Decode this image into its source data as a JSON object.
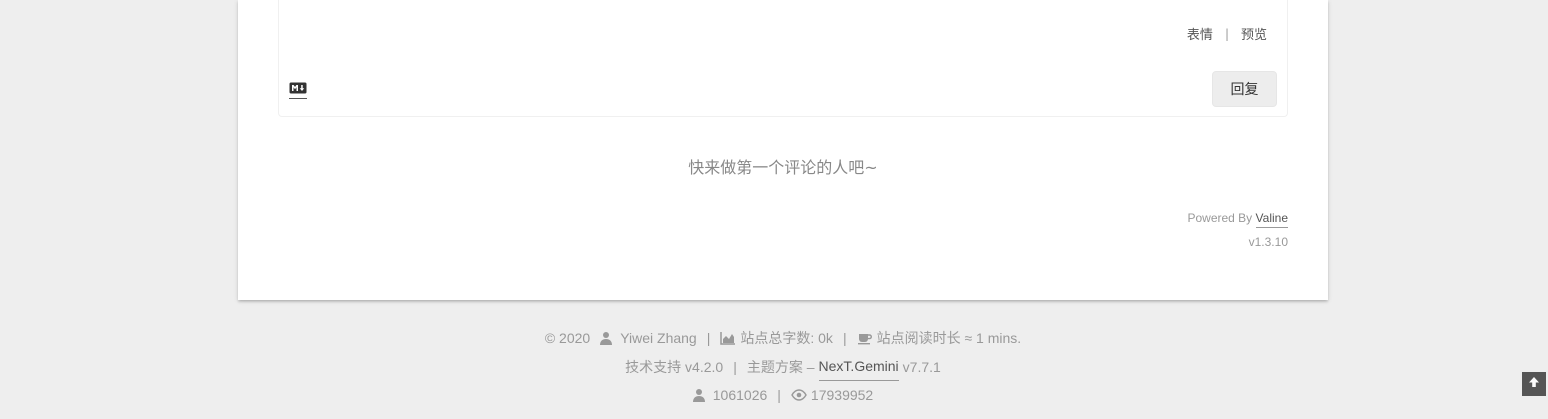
{
  "editor": {
    "emoji_label": "表情",
    "separator": "|",
    "preview_label": "预览",
    "markdown_badge": "M↓",
    "reply_label": "回复"
  },
  "comments": {
    "empty_message": "快来做第一个评论的人吧~"
  },
  "powered_by": {
    "prefix": "Powered By",
    "link_label": "Valine",
    "version": "v1.3.10"
  },
  "footer": {
    "line1": {
      "copyright": "© 2020",
      "author": "Yiwei Zhang",
      "divider": "|",
      "word_count": "站点总字数: 0k",
      "reading_time": "站点阅读时长 ≈ 1 mins."
    },
    "line2": {
      "tech_support": "技术支持 v4.2.0",
      "divider": "|",
      "theme_prefix": "主题方案 –",
      "theme_link": "NexT.Gemini",
      "theme_version": "v7.7.1"
    },
    "line3": {
      "visitors": "1061026",
      "divider": "|",
      "views": "17939952"
    }
  },
  "icons": {
    "user": "user-icon",
    "area_chart": "area-chart-icon",
    "coffee": "coffee-icon",
    "eye": "eye-icon",
    "arrow_up": "arrow-up-icon"
  }
}
